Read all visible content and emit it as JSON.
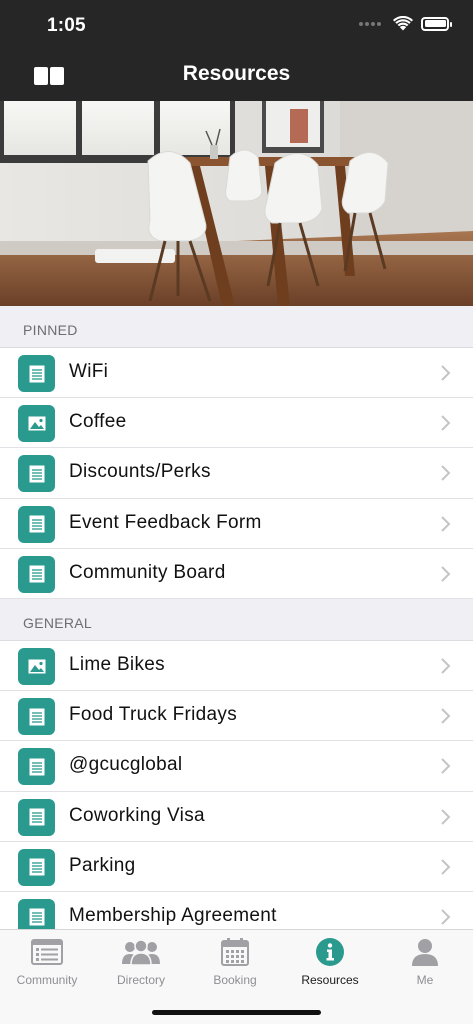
{
  "status_bar": {
    "time": "1:05"
  },
  "nav": {
    "title": "Resources"
  },
  "sections": [
    {
      "header": "PINNED",
      "items": [
        {
          "label": "WiFi",
          "icon": "document-icon"
        },
        {
          "label": "Coffee",
          "icon": "image-icon"
        },
        {
          "label": "Discounts/Perks",
          "icon": "document-icon"
        },
        {
          "label": "Event Feedback Form",
          "icon": "document-icon"
        },
        {
          "label": "Community Board",
          "icon": "document-icon"
        }
      ]
    },
    {
      "header": "GENERAL",
      "items": [
        {
          "label": "Lime Bikes",
          "icon": "image-icon"
        },
        {
          "label": "Food Truck Fridays",
          "icon": "document-icon"
        },
        {
          "label": "@gcucglobal",
          "icon": "document-icon"
        },
        {
          "label": "Coworking Visa",
          "icon": "document-icon"
        },
        {
          "label": "Parking",
          "icon": "document-icon"
        },
        {
          "label": "Membership Agreement",
          "icon": "document-icon"
        }
      ]
    }
  ],
  "tabs": [
    {
      "label": "Community",
      "icon": "community-icon"
    },
    {
      "label": "Directory",
      "icon": "directory-icon"
    },
    {
      "label": "Booking",
      "icon": "calendar-icon"
    },
    {
      "label": "Resources",
      "icon": "info-icon"
    },
    {
      "label": "Me",
      "icon": "person-icon"
    }
  ],
  "active_tab": "Resources",
  "colors": {
    "bar_dark": "#262626",
    "icon_teal": "#2a9a8f",
    "section_bg": "#efeff4"
  }
}
